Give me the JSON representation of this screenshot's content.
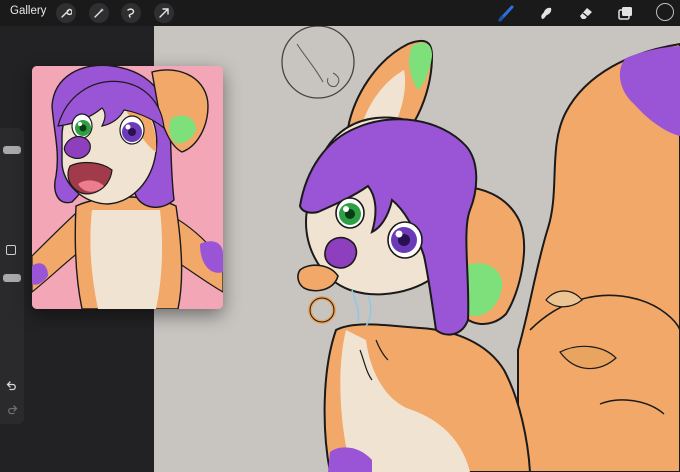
{
  "topbar": {
    "gallery_label": "Gallery",
    "left_actions": [
      "wrench-icon",
      "magic-wand-icon",
      "selection-icon",
      "transform-arrow-icon"
    ],
    "right_tools": [
      "brush-icon",
      "smudge-icon",
      "eraser-icon",
      "layers-icon"
    ],
    "active_tool": "brush-icon",
    "current_color": "#1a1a1a"
  },
  "sidebar": {
    "brush_size_level": 0.9,
    "opacity_level": 0.7,
    "buttons": [
      "modifier-square-icon",
      "undo-icon",
      "redo-icon"
    ]
  },
  "colors": {
    "accent": "#2f6fe0",
    "fur_orange": "#f2a868",
    "hair_purple": "#9a55d6",
    "ear_green": "#7ee07a",
    "cream": "#f1e3d1",
    "canvas_bg": "#c8c5c1",
    "reference_bg": "#f2a6b6"
  }
}
